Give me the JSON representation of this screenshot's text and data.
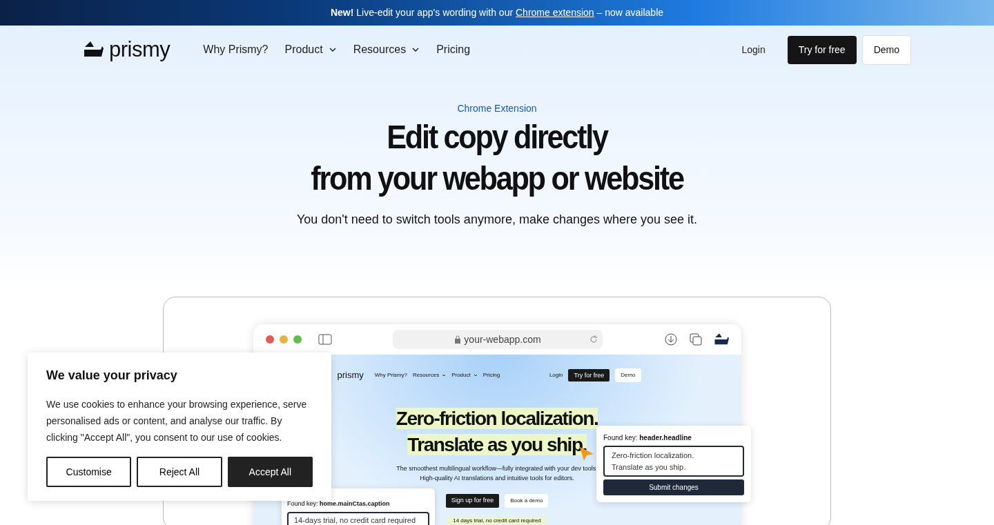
{
  "announcement": {
    "lead": "**New!** Live-edit your app's wording with our",
    "link": "Chrome extension",
    "tail": "– now available"
  },
  "nav": {
    "logo": "prismy",
    "items": [
      {
        "label": "Why Prismy?",
        "dropdown": false
      },
      {
        "label": "Product",
        "dropdown": true
      },
      {
        "label": "Resources",
        "dropdown": true
      },
      {
        "label": "Pricing",
        "dropdown": false
      }
    ],
    "login": "Login",
    "primary": "Try for free",
    "secondary": "Demo"
  },
  "hero": {
    "eyebrow": "Chrome Extension",
    "title": [
      "Edit copy directly",
      "from your webapp or website"
    ],
    "subtitle": "You don't need to switch tools anymore, make changes where you see it."
  },
  "mockup": {
    "url": "your-webapp.com",
    "logo": "prismy",
    "items": [
      {
        "label": "Why Prismy?",
        "dropdown": false
      },
      {
        "label": "Resources",
        "dropdown": true
      },
      {
        "label": "Product",
        "dropdown": true
      },
      {
        "label": "Pricing",
        "dropdown": false
      }
    ],
    "login": "Login",
    "primary": "Try for free",
    "secondary": "Demo",
    "headline": [
      "Zero-friction localization.",
      "Translate as you ship."
    ],
    "subtitle": [
      "The smoothest multilingual workflow—fully integrated with your dev tools.",
      "High-quality AI translations and intuitive tools for editors."
    ],
    "cta_primary": "Sign up for free",
    "cta_secondary": "Book a demo",
    "caption": "14 days trial, no credit card required",
    "editor": {
      "label": "Found key:",
      "key": "header.headline",
      "value": "Zero-friction localization.\nTranslate as you ship.",
      "submit": "Submit changes"
    },
    "editor2": {
      "label": "Found key:",
      "key": "home.mainCtas.caption",
      "value": "14-days trial, no credit card required"
    }
  },
  "cookie": {
    "title": "We value your privacy",
    "text": "We use cookies to enhance your browsing experience, serve personalised ads or content, and analyse our traffic. By clicking \"Accept All\", you consent to our use of cookies.",
    "buttons": [
      {
        "label": "Customise",
        "kind": "outline"
      },
      {
        "label": "Reject All",
        "kind": "outline"
      },
      {
        "label": "Accept All",
        "kind": "solid"
      }
    ]
  }
}
